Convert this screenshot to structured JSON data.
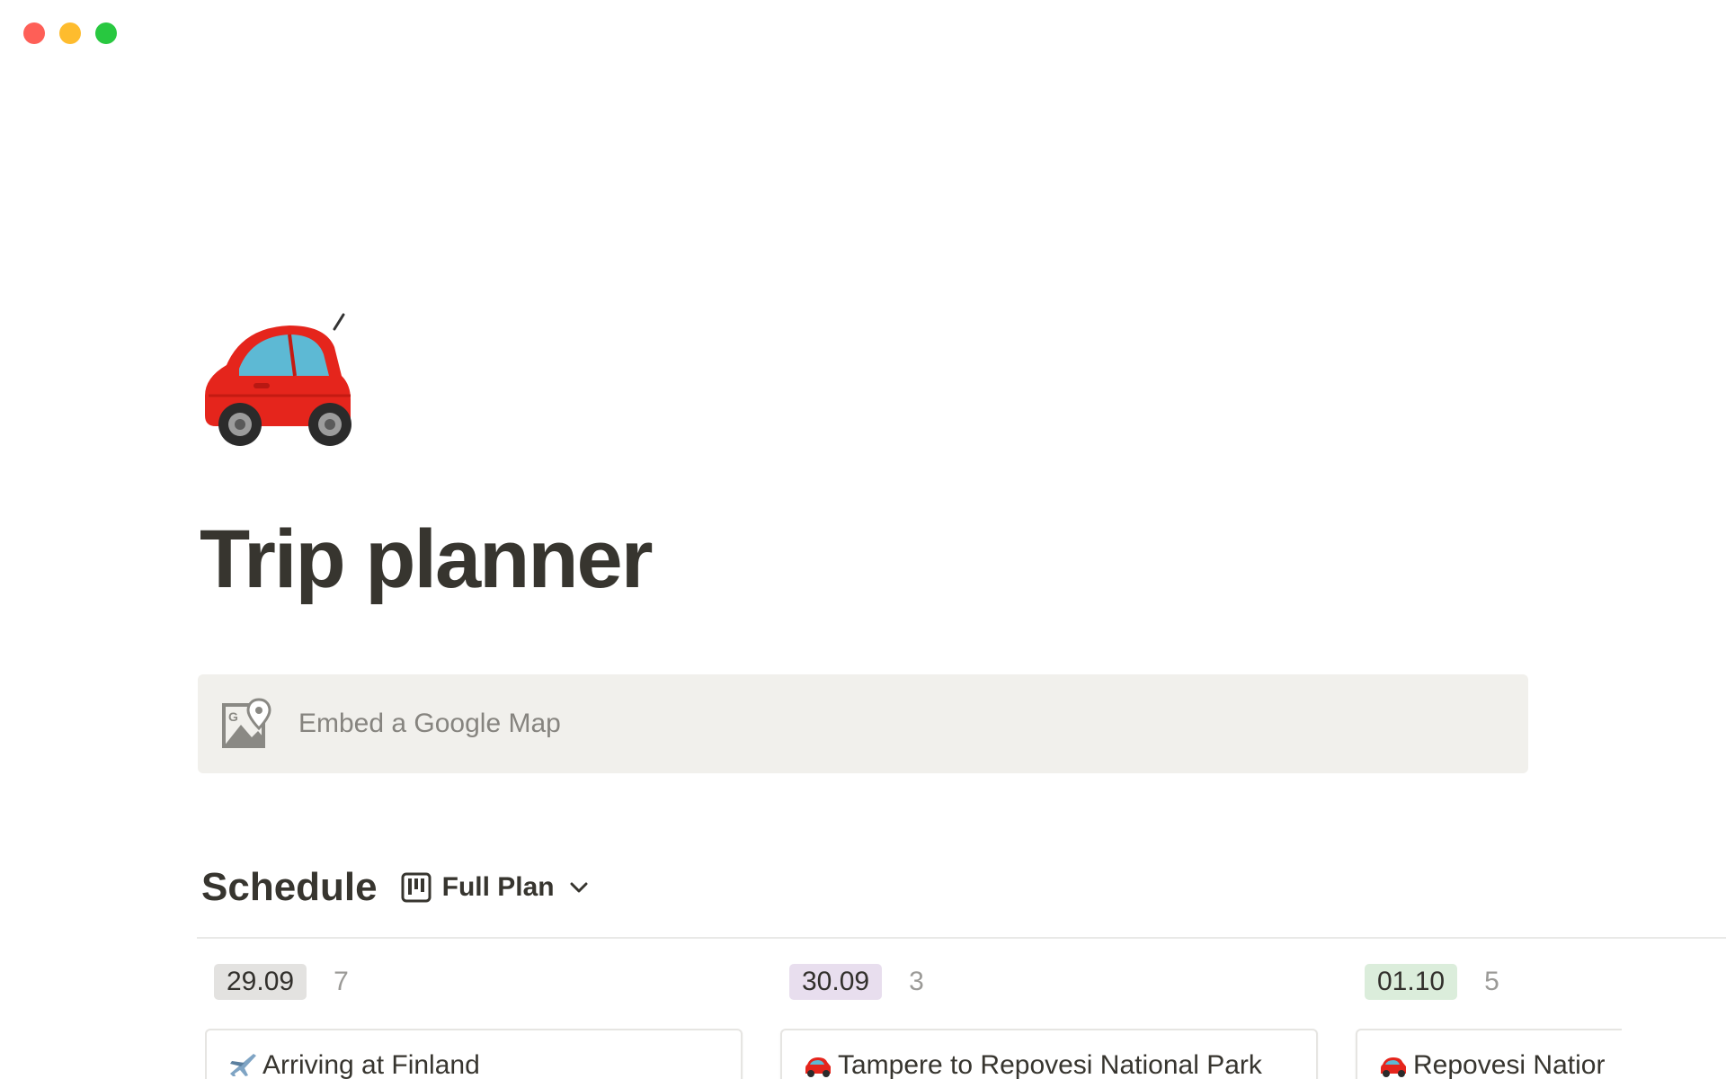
{
  "page": {
    "title": "Trip planner",
    "icon": "red-car-icon"
  },
  "embed": {
    "label": "Embed a Google Map",
    "icon": "google-maps-icon"
  },
  "schedule": {
    "title": "Schedule",
    "view": {
      "label": "Full Plan",
      "icon": "board-view-icon"
    },
    "columns": [
      {
        "date": "29.09",
        "count": "7",
        "tag_color": "#e3e2e0",
        "card": {
          "emoji": "airplane-icon",
          "title": "Arriving at Finland"
        }
      },
      {
        "date": "30.09",
        "count": "3",
        "tag_color": "#e8deee",
        "card": {
          "emoji": "red-car-icon",
          "title": "Tampere to Repovesi National Park"
        }
      },
      {
        "date": "01.10",
        "count": "5",
        "tag_color": "#dbeddb",
        "card": {
          "emoji": "red-car-icon",
          "title": "Repovesi Natior"
        }
      }
    ]
  },
  "colors": {
    "text": "#37352f",
    "embed_bg": "#f1f0ec",
    "muted": "#9b9a97"
  }
}
